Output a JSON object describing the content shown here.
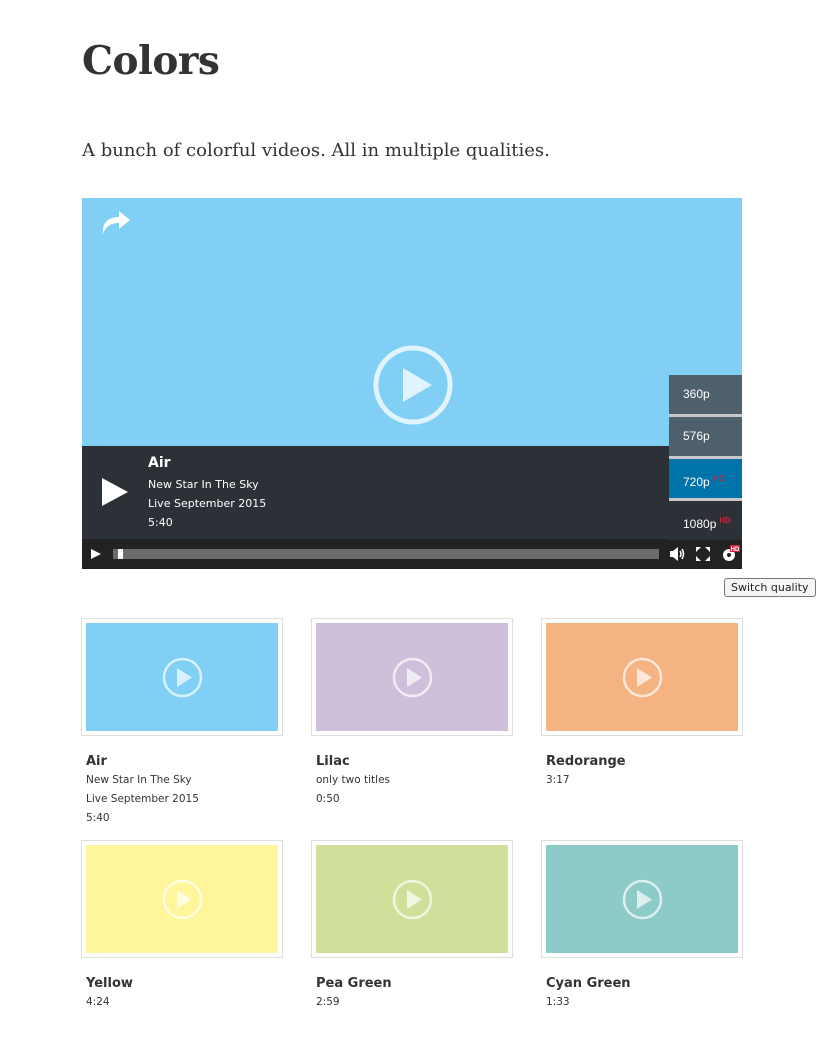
{
  "page": {
    "title": "Colors",
    "description": "A bunch of colorful videos. All in multiple qualities."
  },
  "player": {
    "color": "#81cff4",
    "title": "Air",
    "lines": [
      "New Star In The Sky",
      "Live September 2015",
      "5:40"
    ],
    "progress": 0.01,
    "quality_menu": [
      {
        "label": "360p",
        "hd": ""
      },
      {
        "label": "576p",
        "hd": ""
      },
      {
        "label": "720p",
        "hd": "HD",
        "active": true
      },
      {
        "label": "1080p",
        "hd": "HD"
      }
    ],
    "tooltip": "Switch quality",
    "icons": [
      "share-icon",
      "play-icon",
      "volume-icon",
      "fullscreen-icon",
      "gear-hd-icon"
    ]
  },
  "videos": [
    {
      "title": "Air",
      "color": "#81cff4",
      "lines": [
        "New Star In The Sky",
        "Live September 2015",
        "5:40"
      ]
    },
    {
      "title": "Lilac",
      "color": "#cebfdb",
      "lines": [
        "only two titles",
        "0:50"
      ]
    },
    {
      "title": "Redorange",
      "color": "#f5b383",
      "lines": [
        "3:17"
      ]
    },
    {
      "title": "Yellow",
      "color": "#fff59b",
      "lines": [
        "4:24"
      ]
    },
    {
      "title": "Pea Green",
      "color": "#d0e09b",
      "lines": [
        "2:59"
      ]
    },
    {
      "title": "Cyan Green",
      "color": "#8ccbc8",
      "lines": [
        "1:33"
      ]
    }
  ]
}
